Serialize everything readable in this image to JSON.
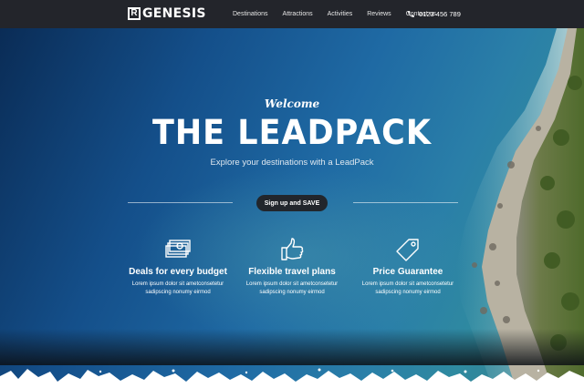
{
  "header": {
    "logo_mark": "R",
    "logo_text": "GENESIS",
    "nav": [
      "Destinations",
      "Attractions",
      "Activities",
      "Reviews",
      "Contact us"
    ],
    "phone": "0123 456 789"
  },
  "hero": {
    "welcome": "Welcome",
    "title": "THE LEADPACK",
    "subtitle": "Explore your destinations with a LeadPack",
    "cta_label": "Sign up and SAVE"
  },
  "features": [
    {
      "icon": "money-icon",
      "title": "Deals for every budget",
      "text": "Lorem ipsum dolor sit ametconsetetur sadipscing nonumy eirmod"
    },
    {
      "icon": "thumbs-up-icon",
      "title": "Flexible travel plans",
      "text": "Lorem ipsum dolor sit ametconsetetur sadipscing nonumy eirmod"
    },
    {
      "icon": "price-tag-icon",
      "title": "Price Guarantee",
      "text": "Lorem ipsum dolor sit ametconsetetur sadipscing nonumy eirmod"
    }
  ],
  "colors": {
    "header_bg": "#23252b",
    "button_bg": "#22262c",
    "sea_deep": "#0a2c56",
    "sea_light": "#2f8aa0"
  }
}
